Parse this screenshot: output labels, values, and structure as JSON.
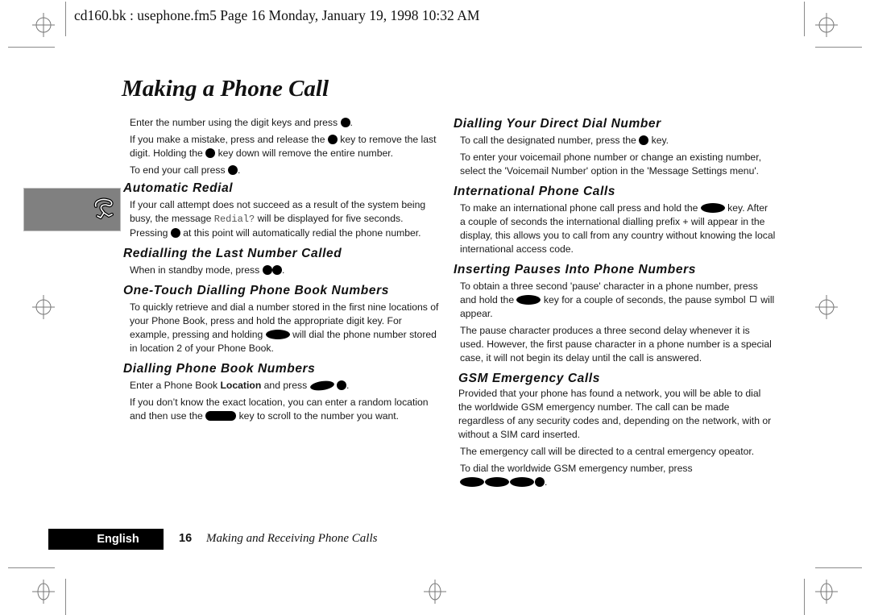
{
  "header": {
    "print_info": "cd160.bk : usephone.fm5  Page 16  Monday, January 19, 1998  10:32 AM"
  },
  "page_title": "Making a Phone Call",
  "section_tab": {
    "icon": "telephone-handset-icon"
  },
  "left_column": {
    "intro": {
      "p1_before": "Enter the number using the digit keys and press ",
      "p1_after": ".",
      "p2_a": "If you make a mistake, press and release the ",
      "p2_b": " key to remove the last digit. Holding the ",
      "p2_c": " key down will remove the entire number.",
      "p3_before": "To end your call press ",
      "p3_after": "."
    },
    "automatic_redial": {
      "heading": "Automatic Redial",
      "p1_a": "If your call attempt does not succeed as a result of the system being busy, the message ",
      "p1_display": "Redial?",
      "p1_b": " will be displayed for five seconds. Pressing ",
      "p1_c": " at this point will automatically redial the phone number."
    },
    "redialling_last": {
      "heading": "Redialling the Last Number Called",
      "p1_before": "When in standby mode, press ",
      "p1_after": "."
    },
    "one_touch": {
      "heading": "One-Touch Dialling Phone Book Numbers",
      "p1_a": "To quickly retrieve and dial a number stored in the first nine locations of your Phone Book, press and hold the appropriate digit key. For example, pressing and holding ",
      "p1_b": " will dial the phone number stored in location 2 of your Phone Book."
    },
    "dialling_phone_book": {
      "heading": "Dialling Phone Book Numbers",
      "p1_a": "Enter a Phone Book ",
      "p1_bold": "Location",
      "p1_b": " and press ",
      "p1_c": ".",
      "p2_a": "If you don’t know the exact location, you can enter a random location and then use the ",
      "p2_b": " key to scroll to the number you want."
    }
  },
  "right_column": {
    "direct_dial": {
      "heading": "Dialling Your Direct Dial Number",
      "p1_a": "To call the designated number, press the ",
      "p1_b": "  key.",
      "p2": "To enter your voicemail phone number or change an existing number, select the 'Voicemail Number' option in the 'Message Settings menu'."
    },
    "international": {
      "heading": "International Phone Calls",
      "p1_a": "To make an international phone call press and hold the ",
      "p1_b": " key. After a couple of seconds the international dialling prefix + will appear in the display, this allows you to call from any country without knowing the local international access code."
    },
    "pauses": {
      "heading": "Inserting Pauses Into Phone Numbers",
      "p1_a": "To obtain a three second 'pause' character in a phone number, press and hold the ",
      "p1_b": " key for a couple of seconds, the pause symbol ",
      "p1_c": " will appear.",
      "p2": "The pause character produces a three second delay whenever it is used. However, the first pause character in a phone number is a special case, it will not begin its delay until the call is answered."
    },
    "gsm_emergency": {
      "heading": "GSM Emergency Calls",
      "p1": "Provided that your phone has found a network, you will be able to dial the worldwide GSM emergency number. The call can be made regardless of any security codes and, depending on the network, with or without a SIM card inserted.",
      "p2": "The emergency call will be directed to a central emergency opeator.",
      "p3": "To dial the worldwide GSM emergency number, press",
      "p3_after": "."
    }
  },
  "footer": {
    "language": "English",
    "page_number": "16",
    "chapter": "Making and Receiving Phone Calls"
  }
}
